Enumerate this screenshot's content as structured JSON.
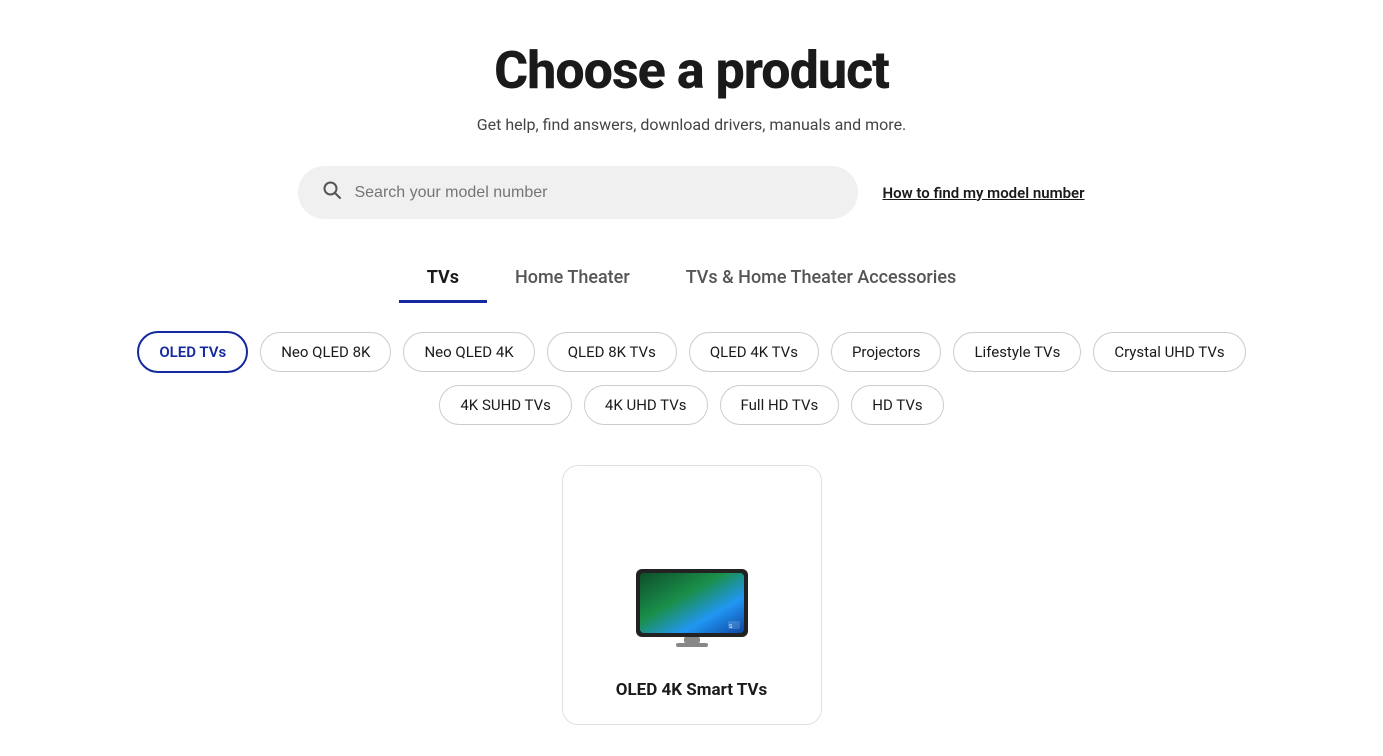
{
  "page": {
    "title": "Choose a product",
    "subtitle": "Get help, find answers, download drivers, manuals and more."
  },
  "search": {
    "placeholder": "Search your model number",
    "find_model_link": "How to find my model number"
  },
  "tabs": [
    {
      "id": "tvs",
      "label": "TVs",
      "active": true
    },
    {
      "id": "home-theater",
      "label": "Home Theater",
      "active": false
    },
    {
      "id": "accessories",
      "label": "TVs & Home Theater Accessories",
      "active": false
    }
  ],
  "chips_row1": [
    {
      "id": "oled-tvs",
      "label": "OLED TVs",
      "active": true
    },
    {
      "id": "neo-qled-8k",
      "label": "Neo QLED 8K",
      "active": false
    },
    {
      "id": "neo-qled-4k",
      "label": "Neo QLED 4K",
      "active": false
    },
    {
      "id": "qled-8k",
      "label": "QLED 8K TVs",
      "active": false
    },
    {
      "id": "qled-4k",
      "label": "QLED 4K TVs",
      "active": false
    },
    {
      "id": "projectors",
      "label": "Projectors",
      "active": false
    },
    {
      "id": "lifestyle-tvs",
      "label": "Lifestyle TVs",
      "active": false
    },
    {
      "id": "crystal-uhd",
      "label": "Crystal UHD TVs",
      "active": false
    }
  ],
  "chips_row2": [
    {
      "id": "4k-suhd",
      "label": "4K SUHD TVs",
      "active": false
    },
    {
      "id": "4k-uhd",
      "label": "4K UHD TVs",
      "active": false
    },
    {
      "id": "full-hd",
      "label": "Full HD TVs",
      "active": false
    },
    {
      "id": "hd-tvs",
      "label": "HD TVs",
      "active": false
    }
  ],
  "products": [
    {
      "id": "oled-4k-smart",
      "name": "OLED 4K Smart TVs"
    }
  ],
  "colors": {
    "accent": "#1428a0",
    "active_border": "#1428a0"
  }
}
